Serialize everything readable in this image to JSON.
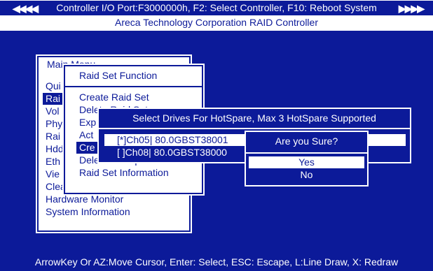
{
  "header": {
    "line1": "Controller I/O Port:F3000000h, F2: Select Controller, F10: Reboot System",
    "line2": "Areca Technology Corporation RAID Controller",
    "left_arrows": "◀◀◀◀",
    "right_arrows": "▶▶▶▶"
  },
  "main_menu": {
    "title": "Main Menu",
    "items": [
      "Qui",
      "Rai",
      "Vol",
      "Phy",
      "Rai",
      "Hdd",
      "Eth",
      "Vie",
      "Clear Event Buffer",
      "Hardware Monitor",
      "System Information"
    ]
  },
  "raid_set_function": {
    "title": "Raid Set Function",
    "items": [
      "Create Raid Set",
      "Delete Raid Set",
      "Exp",
      "Act",
      "Cre",
      "Delete Hot Spare",
      "Raid Set Information"
    ]
  },
  "hotspare_dialog": {
    "title": "Select Drives For HotSpare, Max 3 HotSpare Supported",
    "drives": [
      "[*]Ch05|   80.0GBST38001",
      "[ ]Ch08|   80.0GBST38000"
    ]
  },
  "confirm_dialog": {
    "title": "Are you Sure?",
    "yes": "Yes",
    "no": "No"
  },
  "footer": {
    "help": "ArrowKey Or AZ:Move Cursor, Enter: Select, ESC: Escape, L:Line Draw, X: Redraw"
  },
  "colors": {
    "background": "#0c1a99",
    "foreground": "#ffffff"
  }
}
